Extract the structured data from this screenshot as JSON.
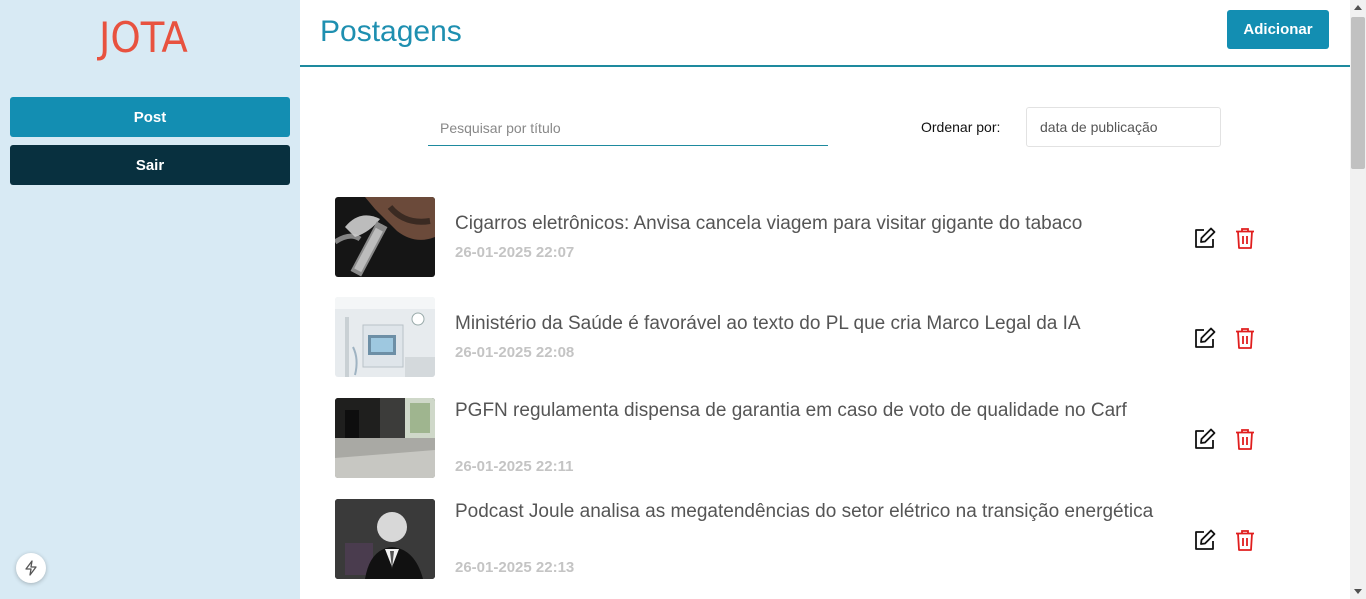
{
  "sidebar": {
    "logo": "JOTA",
    "nav": [
      {
        "label": "Post"
      },
      {
        "label": "Sair"
      }
    ],
    "bolt_icon": "bolt-icon"
  },
  "header": {
    "title": "Postagens",
    "add_label": "Adicionar"
  },
  "filters": {
    "search_placeholder": "Pesquisar por título",
    "order_label": "Ordenar por:",
    "order_value": "data de publicação"
  },
  "posts": [
    {
      "title": "Cigarros eletrônicos: Anvisa cancela viagem para visitar gigante do tabaco",
      "date": "26-01-2025 22:07",
      "image": "man-vaping-photo"
    },
    {
      "title": "Ministério da Saúde é favorável ao texto do PL que cria Marco Legal da IA",
      "date": "26-01-2025 22:08",
      "image": "hospital-equipment-photo"
    },
    {
      "title": "PGFN regulamenta dispensa de garantia em caso de voto de qualidade no Carf",
      "date": "26-01-2025 22:11",
      "image": "building-lobby-photo"
    },
    {
      "title": "Podcast Joule analisa as megatendências do setor elétrico na transição energética",
      "date": "26-01-2025 22:13",
      "image": "man-in-suit-photo"
    }
  ],
  "icons": {
    "edit": "edit-icon",
    "delete": "trash-icon"
  },
  "colors": {
    "primary": "#138eb2",
    "dark": "#08303f",
    "sidebar_bg": "#d8eaf4",
    "logo": "#e8523f",
    "delete": "#e01e1e"
  }
}
